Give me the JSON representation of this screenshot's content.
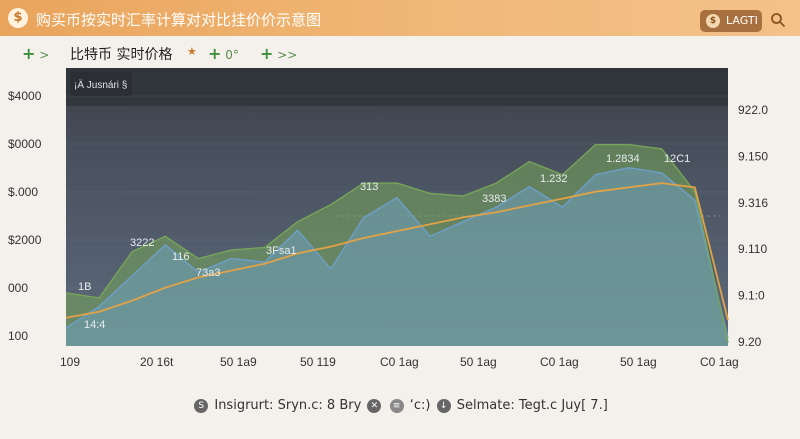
{
  "header": {
    "title": "购买币按实时汇率计算对对比挂价价示意图",
    "login_label": "LAGTI",
    "accent": "#e9a45c"
  },
  "toolbar": {
    "add1_label": ">",
    "title": "比特币 实时价格",
    "add2_label": "0°",
    "add3_label": ">>"
  },
  "footer": {
    "text1": "Insigrurt: Sryn.c: 8 Bry",
    "text2": "‘c:)",
    "text3": "Selmate: Tegt.c Juy[ 7.]"
  },
  "chart_data": {
    "type": "line",
    "overlay_text": "¡Ä Jusnári §",
    "left_ticks": [
      "$4000",
      "$0000",
      "$.000",
      "$2000",
      "000",
      "100"
    ],
    "right_ticks": [
      "922.0",
      "9.150",
      "9.316",
      "9.110",
      "9.1:0",
      "9.20"
    ],
    "x_ticks": [
      "109",
      "20 16t",
      "50 1a9",
      "50 119",
      "C0 1ag",
      "50 1ag",
      "C0 1ag",
      "50 1ag",
      "C0 1ag"
    ],
    "annotations": [
      "1B",
      "3222",
      "116",
      "73a3",
      "3Fsa1",
      "313",
      "3383",
      "1.232",
      "1.2834",
      "12C1",
      "14:4"
    ],
    "x": [
      0,
      5,
      10,
      15,
      20,
      25,
      30,
      35,
      40,
      45,
      50,
      55,
      60,
      65,
      70,
      75,
      80,
      85,
      90,
      95,
      100
    ],
    "series": [
      {
        "color": "#6e9fc8",
        "values": [
          210,
          460,
          820,
          1180,
          860,
          1020,
          980,
          1350,
          900,
          1500,
          1730,
          1280,
          1450,
          1620,
          1860,
          1620,
          2000,
          2080,
          2020,
          1700,
          90
        ]
      },
      {
        "color": "#76a55a",
        "values": [
          620,
          560,
          1100,
          1280,
          1020,
          1120,
          1150,
          1450,
          1650,
          1900,
          1900,
          1780,
          1750,
          1900,
          2150,
          2000,
          2350,
          2350,
          2300,
          1800,
          40
        ]
      },
      {
        "color": "#e2a247",
        "values": [
          330,
          400,
          530,
          680,
          800,
          880,
          960,
          1080,
          1160,
          1260,
          1340,
          1420,
          1500,
          1560,
          1640,
          1720,
          1800,
          1850,
          1900,
          1850,
          300
        ]
      }
    ],
    "ylim": [
      0,
      2800
    ],
    "grid": true
  }
}
